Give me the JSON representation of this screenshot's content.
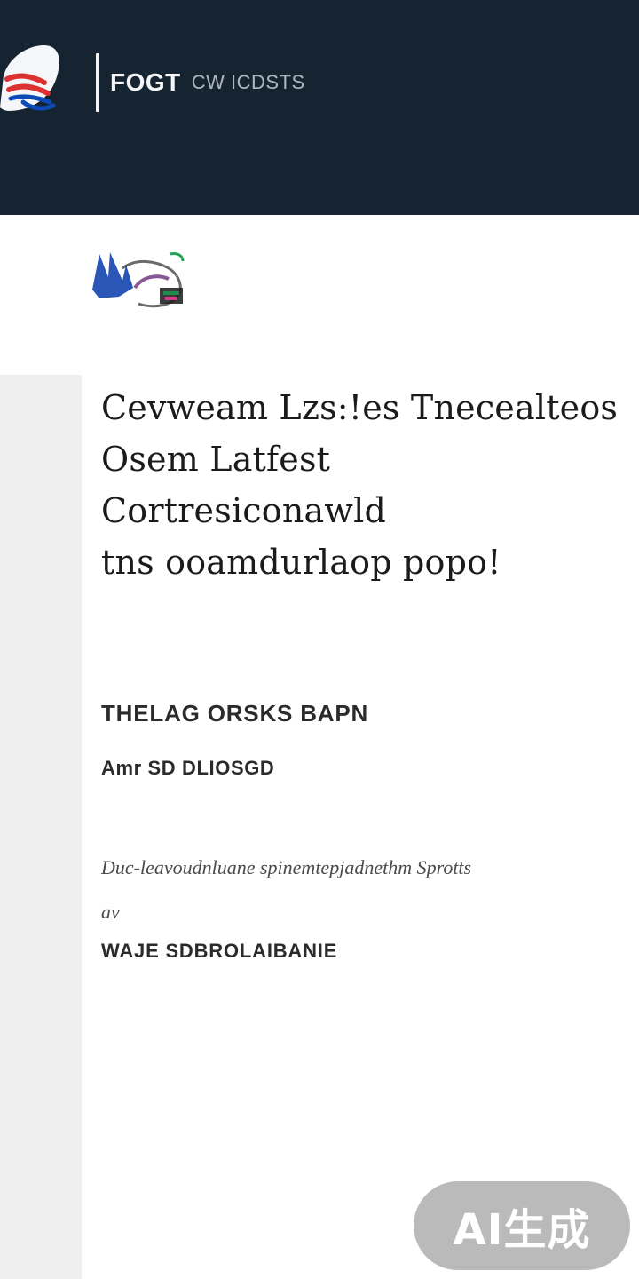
{
  "header": {
    "title": "FOGT",
    "subtitle": "CW ICDSTS",
    "logo_icon": "feather-logo-icon"
  },
  "hero": {
    "illustration_icon": "decorative-illustration"
  },
  "article": {
    "heading_lines": [
      "Cevweam Lzs:!es Tnecealteos",
      "Osem Latfest Cortresiconawld",
      "tns ooamdurlaop popo!"
    ],
    "section_label": "THELAG ORSKS BAPN",
    "meta": "Amr SD DLIOSGD",
    "description_lines": [
      "Duc-leavoudnluane spinemtepjadnethm Sprotts",
      "av"
    ],
    "footer_label": "WAJE SDBROLAIBANIE"
  },
  "badge": {
    "text": "AI生成"
  },
  "colors": {
    "header_bg": "#162331",
    "rail_bg": "#efefef",
    "text_primary": "#1b1b1b"
  }
}
